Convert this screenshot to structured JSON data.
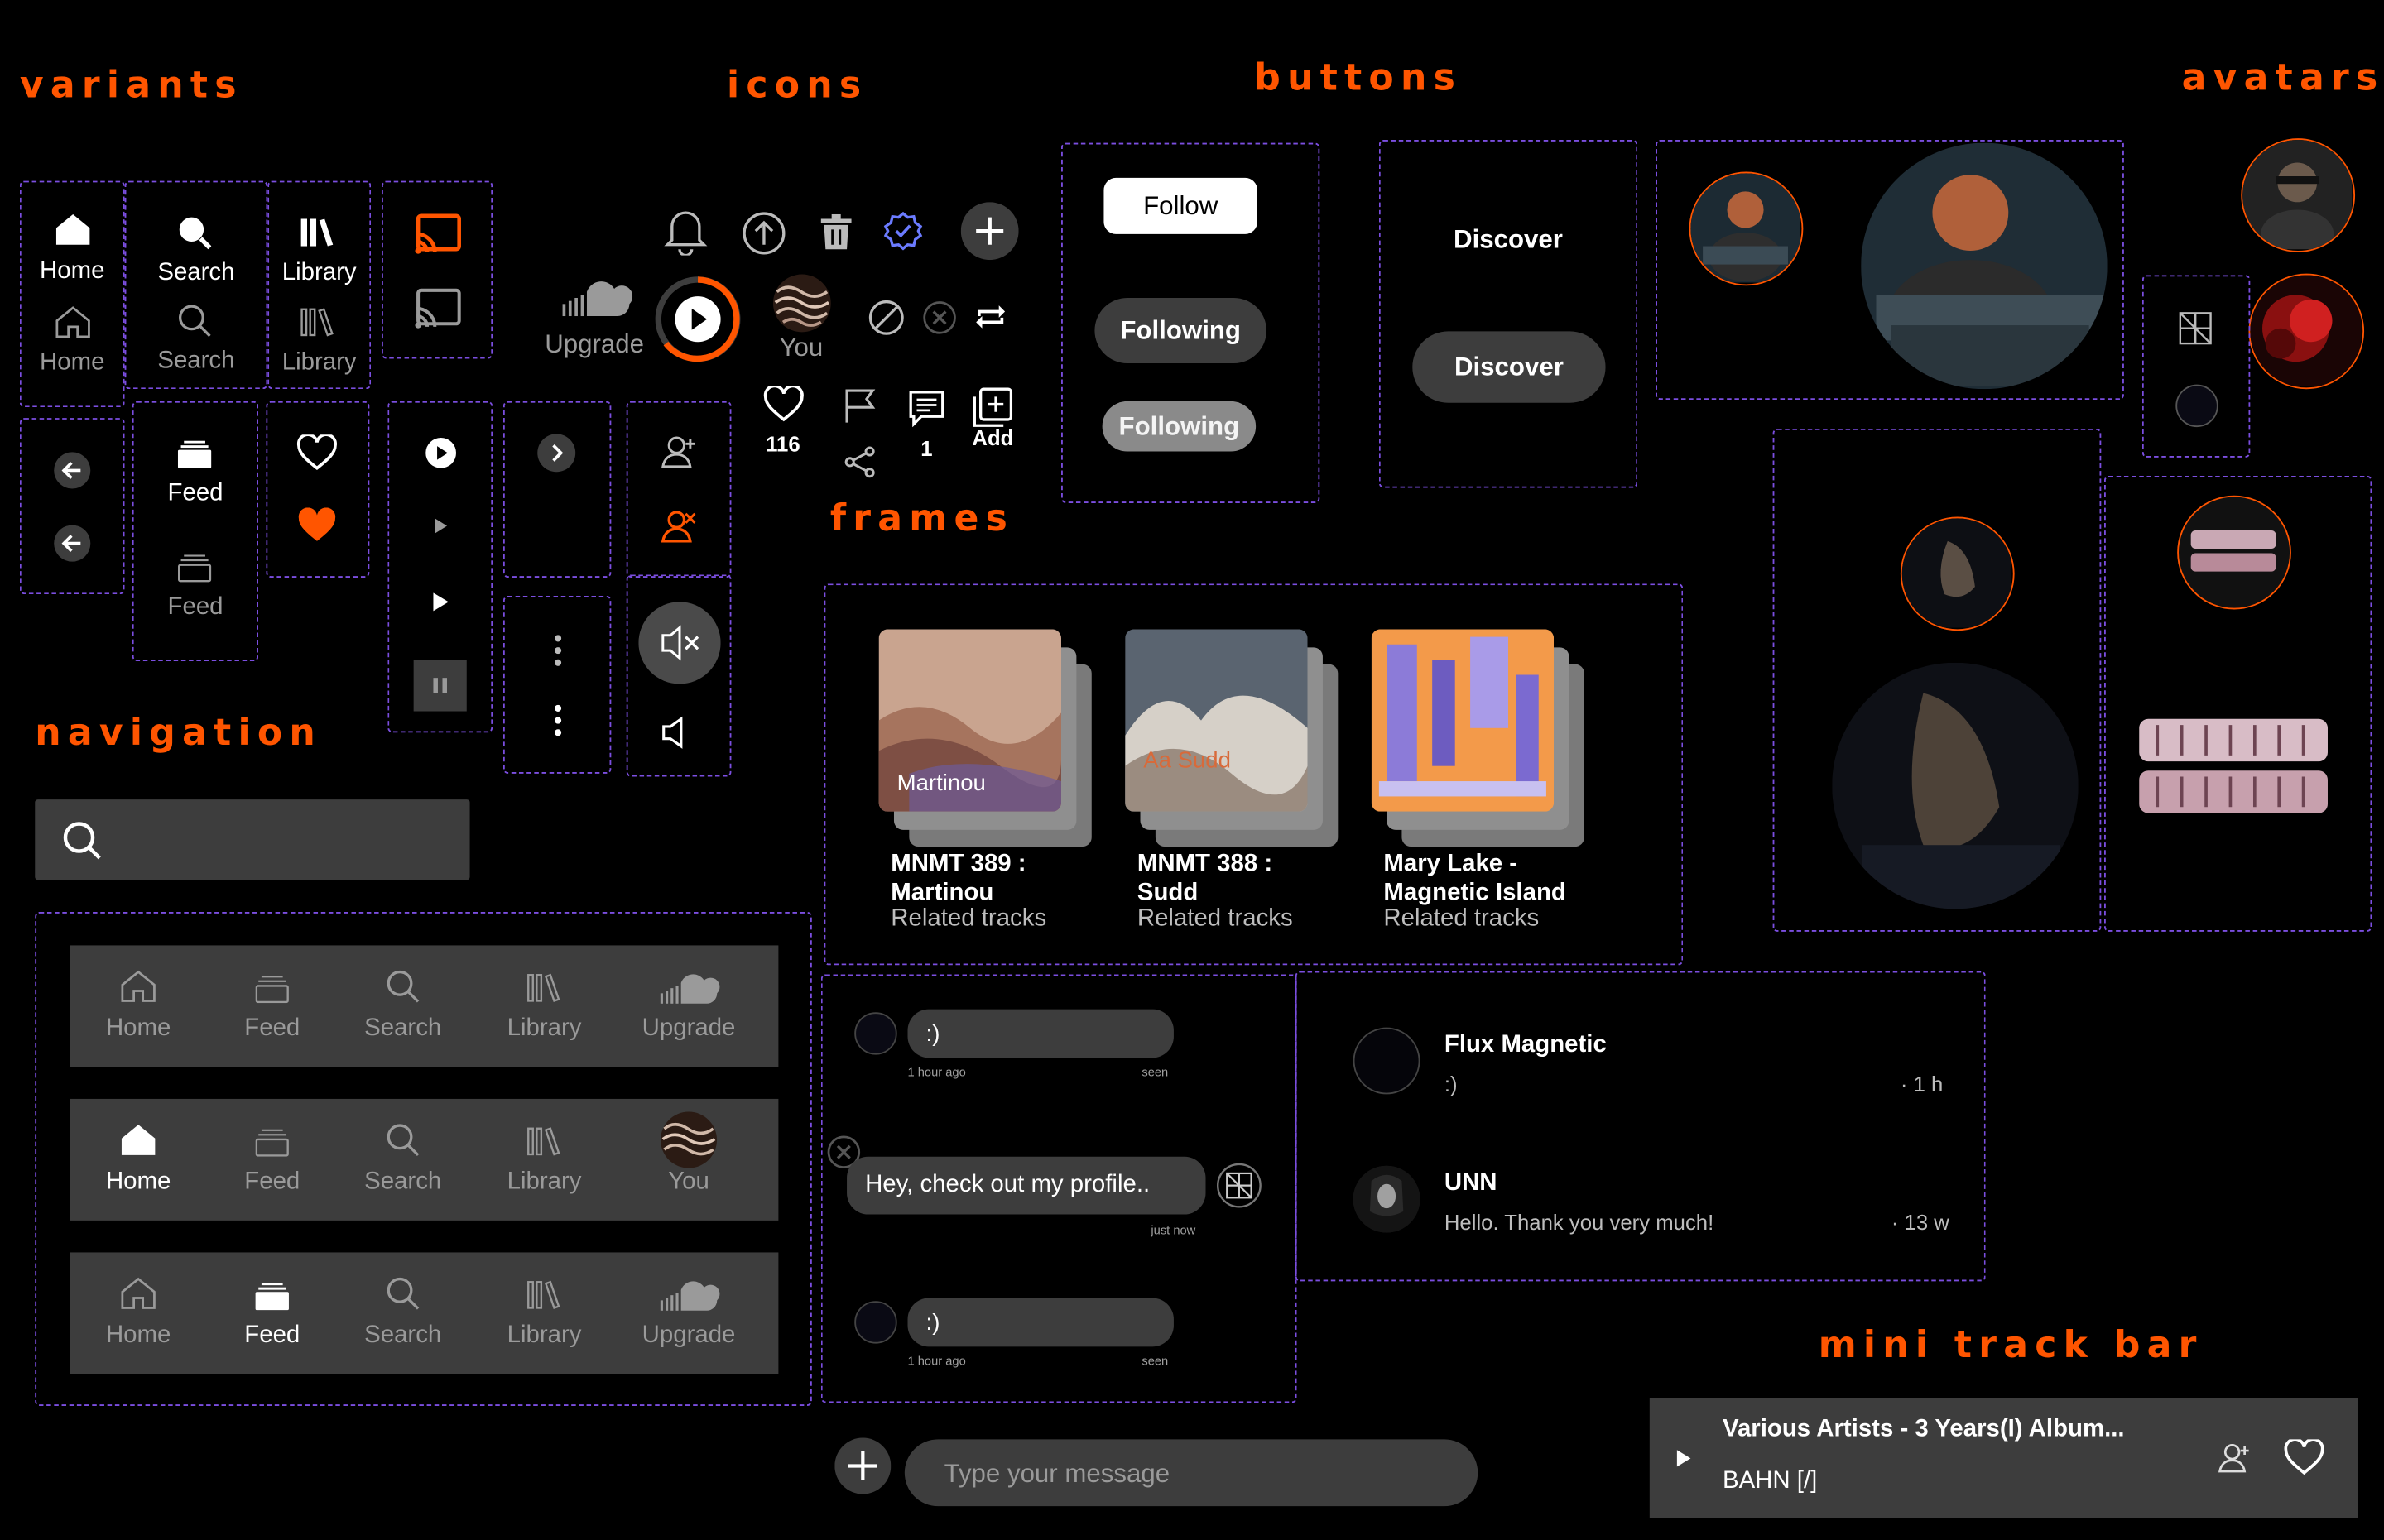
{
  "sections": {
    "variants": "variants",
    "icons": "icons",
    "buttons": "buttons",
    "avatars": "avatars",
    "frames": "frames",
    "navigation": "navigation",
    "mini_track_bar": "mini track bar"
  },
  "variants": {
    "home_active": "Home",
    "home_inactive": "Home",
    "search_active": "Search",
    "search_inactive": "Search",
    "library_active": "Library",
    "library_inactive": "Library",
    "feed_active": "Feed",
    "feed_inactive": "Feed"
  },
  "icons": {
    "upgrade_label": "Upgrade",
    "you_label": "You",
    "likes_count": "116",
    "comments_count": "1",
    "add_label": "Add"
  },
  "buttons": {
    "follow": "Follow",
    "following_dark": "Following",
    "following_light": "Following",
    "discover_text": "Discover",
    "discover_pill": "Discover"
  },
  "frames": [
    {
      "cover_text": "Martinou",
      "title_line1": "MNMT 389 :",
      "title_line2": "Martinou",
      "subtitle": "Related tracks"
    },
    {
      "cover_text": "Aa Sudd",
      "title_line1": "MNMT 388 :",
      "title_line2": "Sudd",
      "subtitle": "Related tracks"
    },
    {
      "cover_text": "",
      "title_line1": "Mary Lake -",
      "title_line2": "Magnetic Island",
      "subtitle": "Related tracks"
    }
  ],
  "navigation": {
    "search_placeholder": "",
    "bars": [
      {
        "active": "none",
        "items": [
          "Home",
          "Feed",
          "Search",
          "Library",
          "Upgrade"
        ]
      },
      {
        "active": "Home",
        "items": [
          "Home",
          "Feed",
          "Search",
          "Library",
          "You"
        ]
      },
      {
        "active": "Feed",
        "items": [
          "Home",
          "Feed",
          "Search",
          "Library",
          "Upgrade"
        ]
      }
    ]
  },
  "chat": {
    "msg1_text": ":)",
    "msg1_time": "1 hour ago",
    "msg1_status": "seen",
    "msg2_text": "Hey, check out my profile..",
    "msg2_time": "just now",
    "msg3_text": ":)",
    "msg3_time": "1 hour ago",
    "msg3_status": "seen",
    "input_placeholder": "Type your message"
  },
  "conversations": [
    {
      "name": "Flux Magnetic",
      "preview": ":)",
      "time": "· 1 h"
    },
    {
      "name": "UNN",
      "preview": "Hello. Thank you very much!",
      "time": "· 13 w"
    }
  ],
  "mini_track": {
    "title": "Various Artists - 3 Years(I) Album...",
    "artist": "BAHN [/]"
  },
  "colors": {
    "accent": "#ff5500",
    "dashed_border": "#7b4ee0",
    "panel": "#3d3d3d",
    "background": "#000000"
  }
}
